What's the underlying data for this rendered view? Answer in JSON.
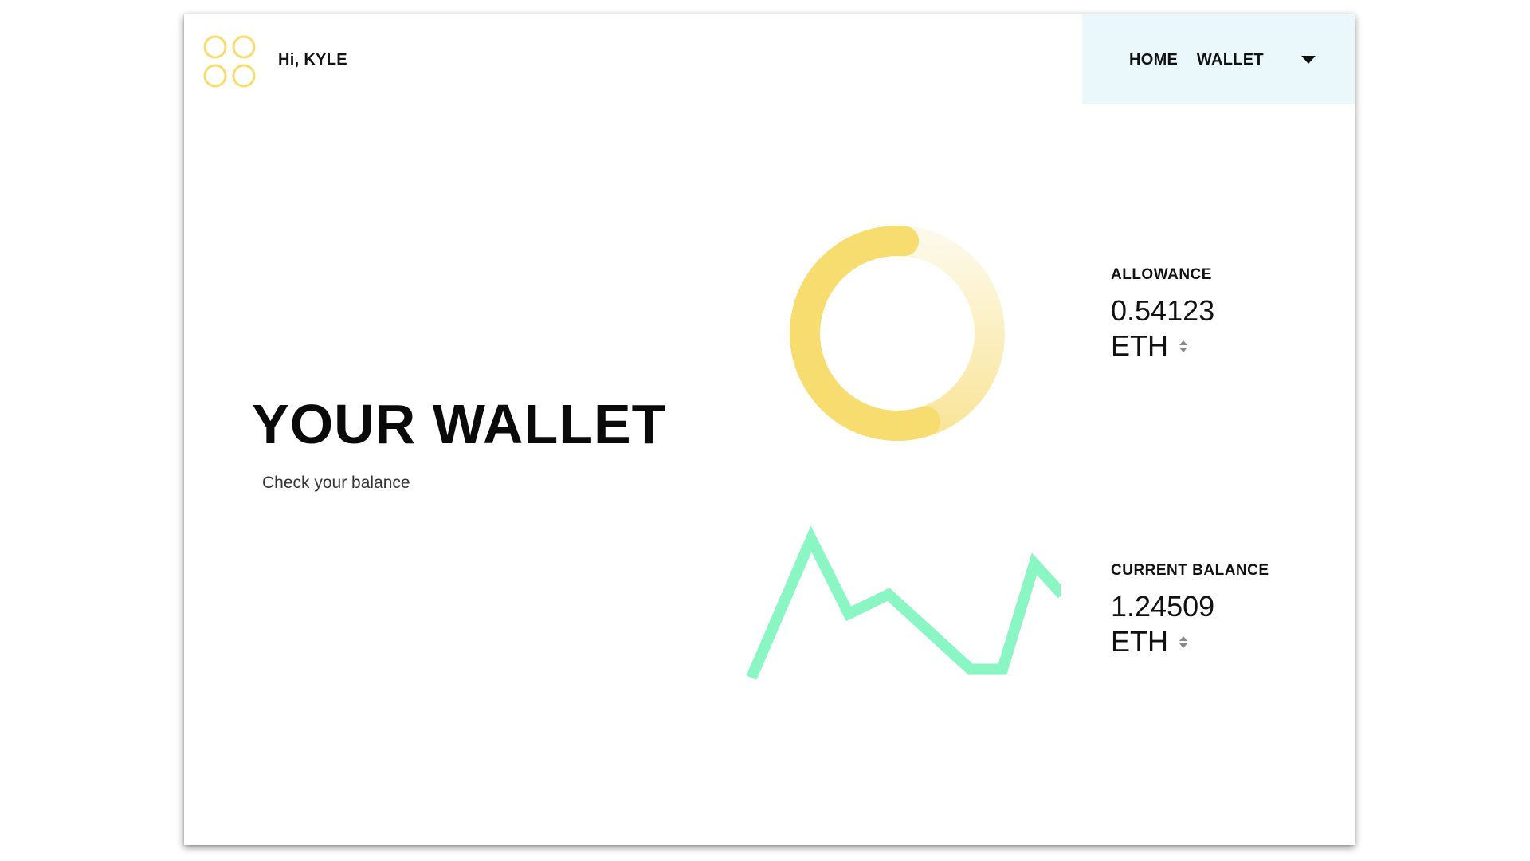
{
  "header": {
    "greeting": "Hi, KYLE",
    "logo_icon": "four-circles-logo-icon",
    "nav": {
      "label": "HOME  WALLET",
      "caret_icon": "caret-down-icon"
    }
  },
  "hero": {
    "title": "YOUR WALLET",
    "subtitle": "Check your balance"
  },
  "stats": {
    "allowance": {
      "label": "ALLOWANCE",
      "value": "0.54123",
      "unit": "ETH",
      "sort_icon": "sort-icon"
    },
    "current_balance": {
      "label": "CURRENT BALANCE",
      "value": "1.24509",
      "unit": "ETH",
      "sort_icon": "sort-icon"
    }
  },
  "colors": {
    "accent_yellow": "#f7dc6f",
    "accent_yellow_light": "#fdf7e0",
    "accent_green": "#8af6c4",
    "nav_background": "#eaf7fb"
  },
  "chart_data": [
    {
      "type": "pie",
      "variant": "donut",
      "values": [
        0.56,
        0.44
      ],
      "colors": [
        "#f7dc6f",
        "#fcefc0"
      ]
    },
    {
      "type": "line",
      "x": [
        0,
        1,
        2,
        3,
        4,
        5,
        6,
        7,
        8
      ],
      "values": [
        0,
        1.0,
        0.46,
        0.6,
        0.06,
        0.06,
        0.82,
        0.5,
        0.5
      ],
      "colors": [
        "#8af6c4"
      ]
    }
  ]
}
